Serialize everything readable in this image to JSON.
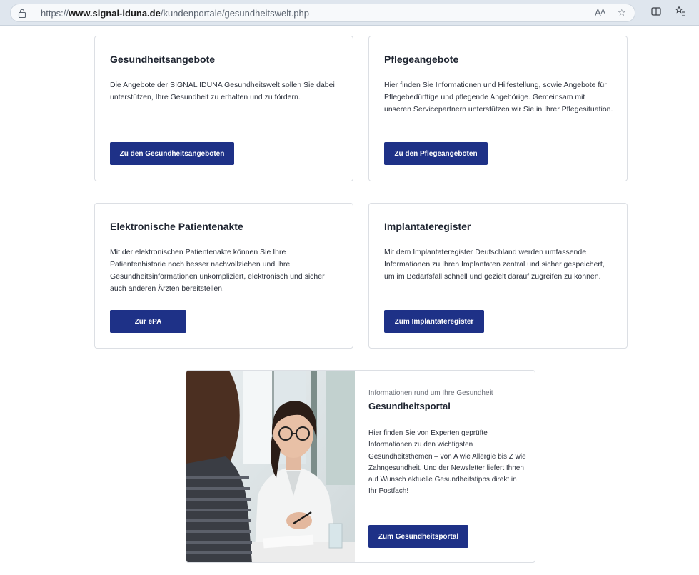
{
  "browser": {
    "url_scheme": "https://",
    "url_host": "www.signal-iduna.de",
    "url_path": "/kundenportale/gesundheitswelt.php",
    "read_aloud_glyph": "Aᴬ",
    "icons": [
      "lock-icon",
      "read-aloud-icon",
      "favorite-star-icon",
      "split-screen-icon",
      "favorites-icon"
    ]
  },
  "cards": [
    {
      "title": "Gesundheitsangebote",
      "text": "Die Angebote der SIGNAL IDUNA Gesundheitswelt sollen Sie dabei unterstützen, Ihre Gesundheit zu erhalten und zu fördern.",
      "button": "Zu den Gesundheitsangeboten"
    },
    {
      "title": "Pflegeangebote",
      "text": "Hier finden Sie Informationen und Hilfestellung, sowie Angebote für Pflegebedürftige und pflegende Angehörige. Gemeinsam mit unseren Servicepartnern unterstützen wir Sie in Ihrer Pflegesituation.",
      "button": "Zu den Pflegeangeboten"
    },
    {
      "title": "Elektronische Patientenakte",
      "text": "Mit der elektronischen Patientenakte können Sie Ihre Patientenhistorie noch besser nachvollziehen und Ihre Gesundheitsinformationen unkompliziert, elektronisch und sicher auch anderen Ärzten bereitstellen.",
      "button": "Zur ePA"
    },
    {
      "title": "Implantateregister",
      "text": "Mit dem Implantateregister Deutschland werden umfassende Informationen zu Ihren Implantaten zentral und sicher gespeichert, um im Bedarfsfall schnell und gezielt darauf zugreifen zu können.",
      "button": "Zum Implantateregister"
    }
  ],
  "portal": {
    "eyebrow": "Informationen rund um Ihre Gesundheit",
    "title": "Gesundheitsportal",
    "text": "Hier finden Sie von Experten geprüfte Informationen zu den wichtigsten Gesundheitsthemen – von A wie Allergie bis Z wie Zahngesundheit. Und der Newsletter liefert Ihnen auf Wunsch aktuelle Gesundheitstipps direkt in Ihr Postfach!",
    "button": "Zum Gesundheitsportal"
  },
  "colors": {
    "brand_button": "#1e3187",
    "card_border": "#dcdfe4",
    "chrome_bg": "#dfe6ee"
  }
}
